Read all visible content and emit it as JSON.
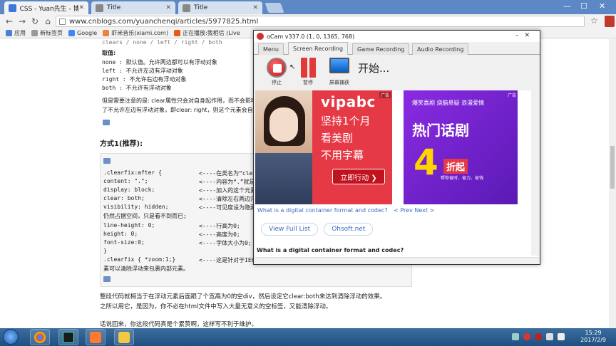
{
  "browser": {
    "tabs": [
      {
        "title": "CSS - Yuan先生 - 博客园",
        "active": true
      },
      {
        "title": "Title",
        "active": false
      },
      {
        "title": "Title",
        "active": false
      }
    ],
    "url": "www.cnblogs.com/yuanchenqi/articles/5977825.html",
    "bookmarks": [
      "应用",
      "新标签页",
      "Google",
      "虾米音乐(xiami.com)",
      "正在播放:我相信 (Live"
    ]
  },
  "article": {
    "top_line": "clears / none / left / right / both",
    "values_heading": "取值:",
    "values": [
      "none : 默认值。允许两边都可以有浮动对象",
      "left : 不允许左边有浮动对象",
      "right : 不允许右边有浮动对象",
      "both : 不允许有浮动对象"
    ],
    "note_line1": "但是需要注意的是: clear属性只会对自身起作用，而不会影响",
    "note_line2": "了不允许左边有浮动对象，即clear: right，则这个元素会自",
    "method_heading": "方式1(推荐):",
    "code": [
      {
        "code": ".clearfix:after {",
        "comment": "<----在类名为“clear"
      },
      {
        "code": "content: \".\";",
        "comment": "<----内容为“.”就是一"
      },
      {
        "code": "display: block;",
        "comment": "<----加入的这个元素转"
      },
      {
        "code": "clear: both;",
        "comment": "<----清除左右两边浮动"
      },
      {
        "code": "visibility: hidden;",
        "comment": "<----可见度设为隐藏"
      },
      {
        "code": "仍然占据空间，只是看不到而已;",
        "comment": ""
      },
      {
        "code": "line-height: 0;",
        "comment": "<----行高为0;"
      },
      {
        "code": "height: 0;",
        "comment": "<----高度为0;"
      },
      {
        "code": "font-size:0;",
        "comment": "<----字体大小为0;"
      },
      {
        "code": "}",
        "comment": ""
      },
      {
        "code": ".clearfix { *zoom:1;}",
        "comment": "<----这是针对于IE6"
      },
      {
        "code": "素可以清除浮动来包裹内部元素。",
        "comment": ""
      }
    ],
    "para1": "整段代码就相当于在浮动元素后面跟了个宽高为0的空div，然后设定它clear:both来达到清除浮动的效果。",
    "para2": "之所以用它，是因为，你不必在html文件中写入大量无意义的空标签，又能清除浮动。",
    "para3": "话说回来，你这段代码真是个累赘啊，这样写不利于维护。"
  },
  "ocam": {
    "title": "oCam v337.0 (1, 0, 1365, 768)",
    "tabs": [
      "Menu",
      "Screen Recording",
      "Game Recording",
      "Audio Recording"
    ],
    "active_tab": "Screen Recording",
    "tools": [
      {
        "label": "停止",
        "icon": "record-stop-icon"
      },
      {
        "label": "暂停",
        "icon": "pause-icon"
      },
      {
        "label": "屏幕捕获",
        "icon": "screen-capture-icon"
      }
    ],
    "status": "开始...",
    "ad_left": {
      "brand": "vipabc",
      "line1": "坚持1个月",
      "line2": "看美剧",
      "line3": "不用字幕",
      "cta": "立即行动 ❯",
      "tag": "广告"
    },
    "ad_right": {
      "line1": "爆笑喜剧 烧脑悬疑 浪漫爱情",
      "line2": "热门话剧",
      "big": "4",
      "suffix": "折起",
      "line3": "帮你省时、省力、省钱",
      "tag": "广告"
    },
    "link_text": "What is a digital container format and codec?",
    "nav_text": "< Prev Next >",
    "buttons": [
      "View Full List",
      "Ohsoft.net"
    ],
    "question": "What is a digital container format and codec?"
  },
  "taskbar": {
    "time": "15:29",
    "date": "2017/2/9"
  },
  "colors": {
    "tabbar": "#5c88c6",
    "link": "#3b6bc4",
    "ad_red": "#e63946",
    "ad_purple": "#8a2be2",
    "taskbar": "#1e4f80"
  }
}
